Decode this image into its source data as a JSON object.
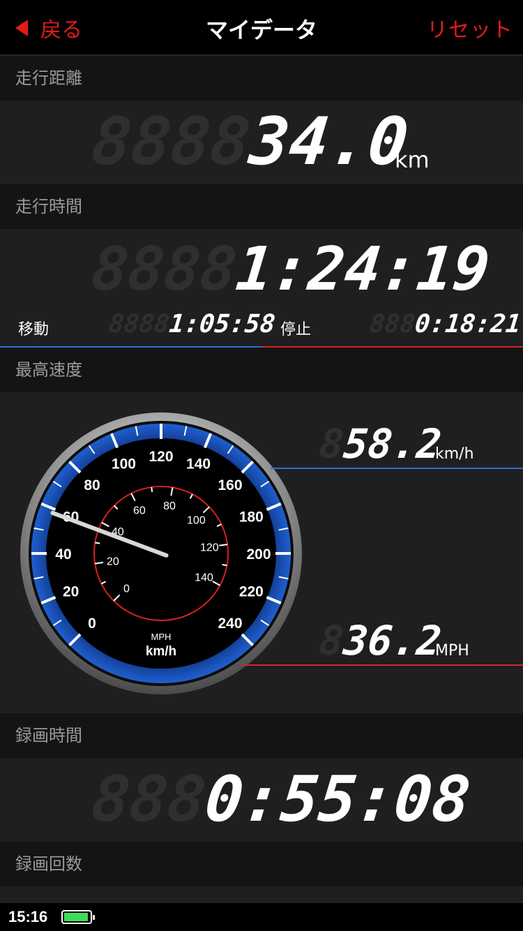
{
  "nav": {
    "back_label": "戻る",
    "title": "マイデータ",
    "reset_label": "リセット"
  },
  "distance": {
    "label": "走行距離",
    "ghost": "8888",
    "value": "34.0",
    "unit": "km"
  },
  "drive_time": {
    "label": "走行時間",
    "ghost": "8888",
    "value": "1:24:19",
    "moving_label": "移動",
    "moving_ghost": "8888",
    "moving_value": "1:05:58",
    "stopped_label": "停止",
    "stopped_ghost": "888",
    "stopped_value": "0:18:21"
  },
  "max_speed": {
    "label": "最高速度",
    "kmh_ghost": "8",
    "kmh_value": "58.2",
    "kmh_unit": "km/h",
    "mph_ghost": "8",
    "mph_value": "36.2",
    "mph_unit": "MPH",
    "gauge": {
      "outer_ticks": [
        "0",
        "20",
        "40",
        "60",
        "80",
        "100",
        "120",
        "140",
        "160",
        "180",
        "200",
        "220",
        "240"
      ],
      "inner_ticks": [
        "0",
        "20",
        "40",
        "60",
        "80",
        "100",
        "120",
        "140"
      ],
      "mph_label": "MPH",
      "kmh_label": "km/h",
      "needle_value_kmh": 58.2,
      "accent_color": "#1f5fd0",
      "inner_ring_color": "#d62020"
    }
  },
  "record_time": {
    "label": "録画時間",
    "ghost": "888",
    "value": "0:55:08"
  },
  "record_count": {
    "label": "録画回数"
  },
  "status_bar": {
    "time": "15:16",
    "battery_color": "#3cde58"
  }
}
